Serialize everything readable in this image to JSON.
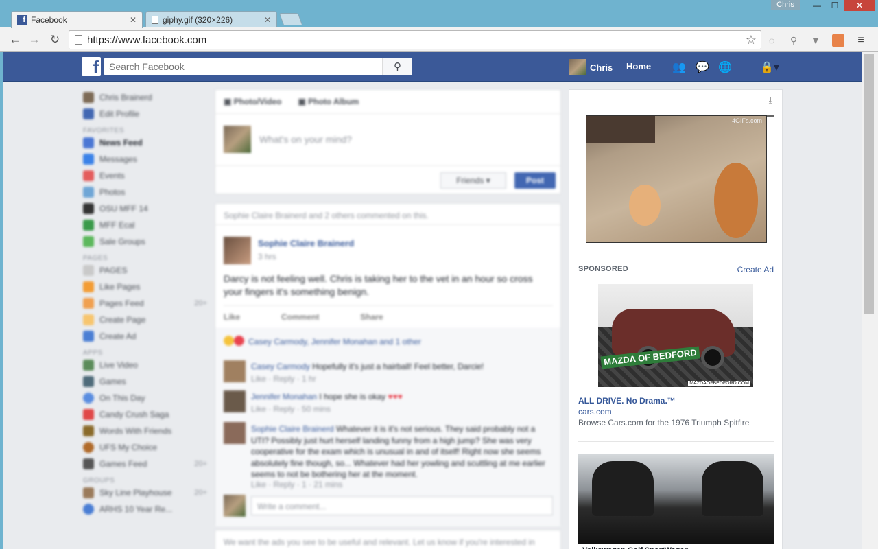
{
  "browser": {
    "tabs": [
      {
        "title": "Facebook",
        "active": true
      },
      {
        "title": "giphy.gif (320×226)",
        "active": false
      }
    ],
    "user_chip": "Chris",
    "url": "https://www.facebook.com",
    "window_buttons": {
      "minimize": "—",
      "maximize": "☐",
      "close": "✕"
    }
  },
  "fb_header": {
    "logo": "f",
    "search_placeholder": "Search Facebook",
    "profile_name": "Chris",
    "home_label": "Home"
  },
  "left_nav": {
    "profile_items": [
      "Chris Brainerd",
      "Edit Profile"
    ],
    "favorites_header": "FAVORITES",
    "favorites": [
      "News Feed",
      "Messages",
      "Events",
      "Photos",
      "OSU MFF 14",
      "MFF Ecal",
      "Sale Groups"
    ],
    "pages_header": "PAGES",
    "pages": [
      {
        "label": "PAGES",
        "count": ""
      },
      {
        "label": "Like Pages",
        "count": ""
      },
      {
        "label": "Pages Feed",
        "count": "20+"
      },
      {
        "label": "Create Page",
        "count": ""
      },
      {
        "label": "Create Ad",
        "count": ""
      }
    ],
    "apps_header": "APPS",
    "apps": [
      {
        "label": "Live Video",
        "count": ""
      },
      {
        "label": "Games",
        "count": ""
      },
      {
        "label": "On This Day",
        "count": ""
      },
      {
        "label": "Candy Crush Saga",
        "count": ""
      },
      {
        "label": "Words With Friends",
        "count": ""
      },
      {
        "label": "UFS My Choice",
        "count": ""
      },
      {
        "label": "Games Feed",
        "count": "20+"
      }
    ],
    "groups_header": "GROUPS",
    "groups": [
      {
        "label": "Sky Line Playhouse",
        "count": "20+"
      },
      {
        "label": "ARHS 10 Year Re...",
        "count": ""
      }
    ]
  },
  "composer": {
    "photo_video": "Photo/Video",
    "photo_album": "Photo Album",
    "placeholder": "What's on your mind?",
    "audience": "Friends",
    "post_button": "Post"
  },
  "post": {
    "context": "Sophie Claire Brainerd and 2 others commented on this.",
    "author": "Sophie Claire Brainerd",
    "time": "3 hrs",
    "text": "Darcy is not feeling well. Chris is taking her to the vet in an hour so cross your fingers it's something benign.",
    "actions": [
      "Like",
      "Comment",
      "Share"
    ],
    "reactions": "Casey Carmody, Jennifer Monahan and 1 other",
    "comments": [
      {
        "author": "Casey Carmody",
        "text": "Hopefully it's just a hairball! Feel better, Darcie!",
        "meta": "Like · Reply · 1 hr"
      },
      {
        "author": "Jennifer Monahan",
        "text": "I hope she is okay",
        "meta": "Like · Reply · 50 mins"
      },
      {
        "author": "Sophie Claire Brainerd",
        "text": "Whatever it is it's not serious. They said probably not a UTI? Possibly just hurt herself landing funny from a high jump? She was very cooperative for the exam which is unusual in and of itself! Right now she seems absolutely fine though, so... Whatever had her yowling and scuttling at me earlier seems to not be bothering her at the moment.",
        "meta": "Like · Reply · 1 · 21 mins"
      }
    ],
    "comment_placeholder": "Write a comment..."
  },
  "footer_note": "We want the ads you see to be useful and relevant. Let us know if you're interested in",
  "right_col": {
    "gif_watermark": "4GIFs.com",
    "sponsored_label": "SPONSORED",
    "create_ad": "Create Ad",
    "ad1": {
      "badge": "MAZDA OF BEDFORD",
      "image_url_text": "MAZDAOFBEDFORD.COM",
      "title": "ALL DRIVE. No Drama.™",
      "domain": "cars.com",
      "body": "Browse Cars.com for the 1976 Triumph Spitfire"
    },
    "ad2": {
      "title": "Volkswagen Golf SportWagen"
    }
  },
  "colors": {
    "fb_blue": "#3b5998",
    "link": "#365899",
    "page_bg": "#e9ebee",
    "chrome_frame": "#6fb3cf"
  }
}
